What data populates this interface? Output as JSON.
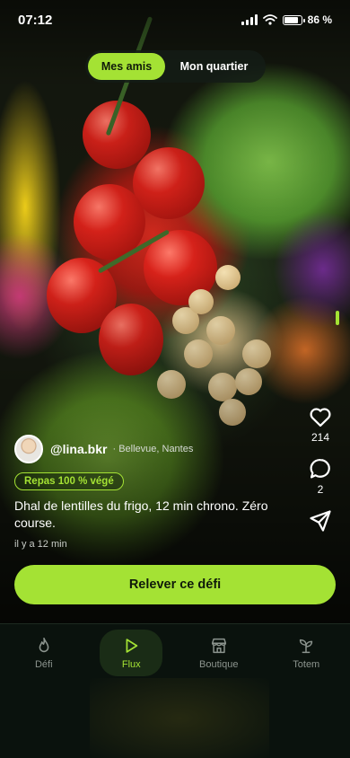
{
  "status_bar": {
    "time": "07:12",
    "battery_percent": 86,
    "battery_label": "86 %"
  },
  "feed_toggle": {
    "options": [
      "Mes amis",
      "Mon quartier"
    ],
    "selected": "Mes amis"
  },
  "post": {
    "handle": "@lina.bkr",
    "location": "Bellevue, Nantes",
    "badge": "Repas 100 % végé",
    "caption": "Dhal de lentilles du frigo, 12 min chrono. Zéro course.",
    "time_ago": "il y a 12 min",
    "likes": "214",
    "comments": "2",
    "liked": false
  },
  "cta": {
    "label": "Relever ce défi"
  },
  "nav": {
    "items": [
      {
        "label": "Défi",
        "icon": "flame-icon"
      },
      {
        "label": "Flux",
        "icon": "play-icon",
        "active": true
      },
      {
        "label": "Boutique",
        "icon": "store-icon"
      },
      {
        "label": "Totem",
        "icon": "sprout-icon"
      }
    ]
  },
  "colors": {
    "accent": "#a4e234",
    "background": "#0a120d"
  }
}
